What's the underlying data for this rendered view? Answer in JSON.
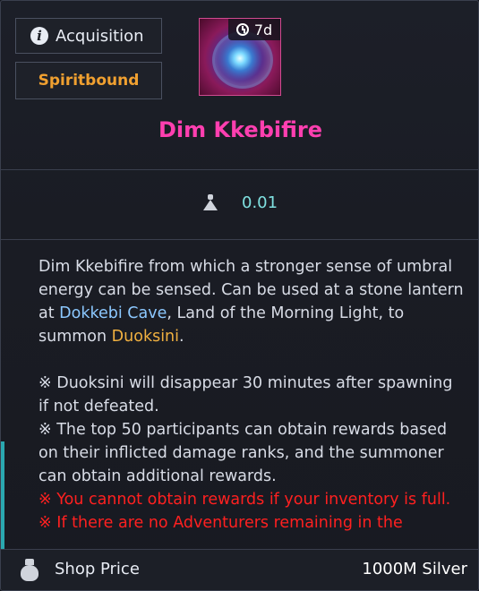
{
  "tooltip": {
    "acquisition_label": "Acquisition",
    "bind_status": "Spiritbound",
    "timer": "7d",
    "item_name": "Dim Kkebifire",
    "weight": "0.01",
    "description": {
      "p1_a": "Dim Kkebifire from which a stronger sense of umbral energy can be sensed. Can be used at a stone lantern at ",
      "p1_loc": "Dokkebi Cave",
      "p1_b": ", Land of the Morning Light, to summon ",
      "p1_boss": "Duoksini",
      "p1_end": ".",
      "note1": "※ Duoksini will disappear 30 minutes after spawning if not defeated.",
      "note2": "※ The top 50 participants can obtain rewards based on their inflicted damage ranks, and the summoner can obtain additional rewards.",
      "warn1": "※ You cannot obtain rewards if your inventory is full.",
      "warn2": "※ If there are no Adventurers remaining in the"
    },
    "footer": {
      "label": "Shop Price",
      "value": "1000M Silver"
    }
  },
  "icons": {
    "acquisition": "info-icon",
    "timer": "clock-icon",
    "weight": "weight-icon",
    "shop": "money-bag-icon"
  },
  "colors": {
    "item_name": "#ff3fb0",
    "bind_status": "#f0a030",
    "location_highlight": "#8cc8ff",
    "boss_highlight": "#f0b040",
    "warning": "#ff2020",
    "weight_value": "#7fe0e0"
  }
}
